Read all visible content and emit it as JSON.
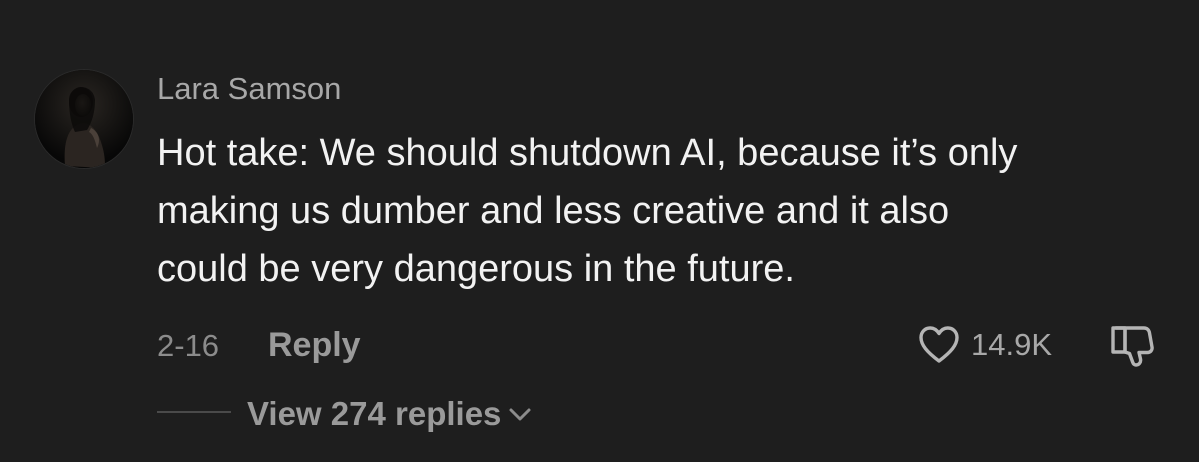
{
  "comment": {
    "username": "Lara Samson",
    "text_lines": [
      "Hot take: We should shutdown AI, because it’s only",
      "making us dumber and less creative and it also",
      "could be very dangerous in the future."
    ],
    "date": "2-16",
    "reply_label": "Reply",
    "like_count": "14.9K",
    "view_replies_label": "View 274 replies",
    "avatar_icon": "profile-photo",
    "like_icon": "heart-outline-icon",
    "dislike_icon": "thumbs-down-outline-icon",
    "expand_icon": "chevron-down-icon"
  },
  "colors": {
    "background": "#1e1e1e",
    "username": "#a8a8a8",
    "body_text": "#f2f2f2",
    "muted": "#8c8c8c",
    "action": "#9a9a9a"
  }
}
